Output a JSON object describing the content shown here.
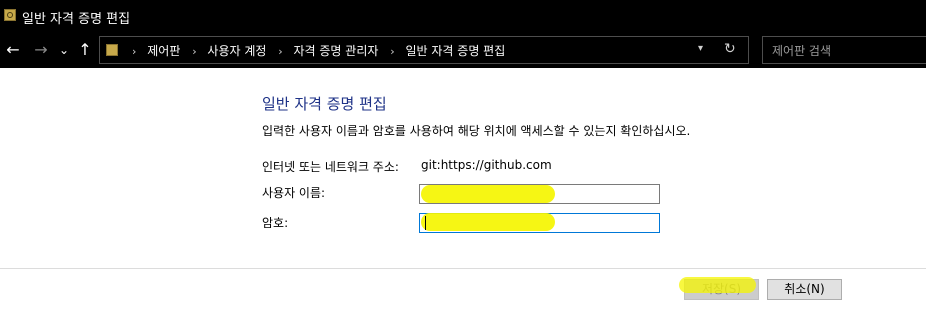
{
  "window": {
    "title": "일반 자격 증명 편집",
    "icon": "control-panel-icon"
  },
  "nav": {
    "back_glyph": "←",
    "forward_glyph": "→",
    "recent_glyph": "⌄",
    "up_glyph": "↑",
    "breadcrumbs": [
      "제어판",
      "사용자 계정",
      "자격 증명 관리자",
      "일반 자격 증명 편집"
    ],
    "separator": "›",
    "refresh_glyph": "↻",
    "search_placeholder": "제어판 검색"
  },
  "form": {
    "heading": "일반 자격 증명 편집",
    "description": "입력한 사용자 이름과 암호를 사용하여 해당 위치에 액세스할 수 있는지 확인하십시오.",
    "address_label": "인터넷 또는 네트워크 주소:",
    "address_value": "git:https://github.com",
    "username_label": "사용자 이름:",
    "username_value": "",
    "password_label": "암호:",
    "password_value": ""
  },
  "buttons": {
    "save": "저장(S)",
    "cancel": "취소(N)"
  },
  "colors": {
    "heading": "#1e3287",
    "highlight": "#f5f500",
    "focus_border": "#0078d7",
    "chrome": "#000000"
  }
}
